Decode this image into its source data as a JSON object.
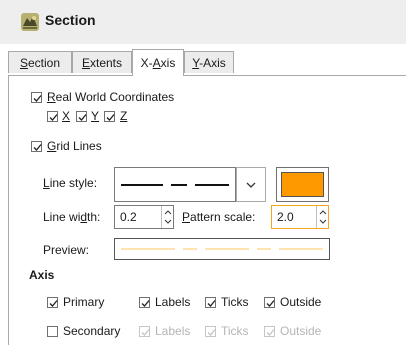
{
  "window": {
    "title": "Section",
    "icon": "section-app-icon"
  },
  "tabs": [
    {
      "label_pre": "",
      "label_key": "S",
      "label_post": "ection",
      "active": false
    },
    {
      "label_pre": "",
      "label_key": "E",
      "label_post": "xtents",
      "active": false
    },
    {
      "label_pre": "X-",
      "label_key": "A",
      "label_post": "xis",
      "active": true
    },
    {
      "label_pre": "",
      "label_key": "Y",
      "label_post": "-Axis",
      "active": false
    }
  ],
  "real_world": {
    "checked": true,
    "label_key": "R",
    "label_rest": "eal World Coordinates",
    "coords": [
      {
        "label": "X",
        "checked": true
      },
      {
        "label": "Y",
        "checked": true
      },
      {
        "label": "Z",
        "checked": true
      }
    ]
  },
  "grid_lines": {
    "checked": true,
    "label_key": "G",
    "label_rest": "rid Lines"
  },
  "line_style": {
    "label_key": "L",
    "label_rest": "ine style:",
    "dropdown_icon": "chevron-down-icon"
  },
  "line_color": {
    "color": "#ff9900"
  },
  "line_width": {
    "label_pre": "Line wi",
    "label_key": "d",
    "label_post": "th:",
    "value": "0.2"
  },
  "pattern_scale": {
    "label_key": "P",
    "label_rest": "attern scale:",
    "value": "2.0"
  },
  "preview": {
    "label": "Preview:"
  },
  "axis": {
    "heading": "Axis",
    "primary": {
      "label": "Primary",
      "checked": true,
      "options": [
        {
          "label": "Labels",
          "checked": true
        },
        {
          "label": "Ticks",
          "checked": true
        },
        {
          "label": "Outside",
          "checked": true
        }
      ]
    },
    "secondary": {
      "label": "Secondary",
      "checked": false,
      "options": [
        {
          "label": "Labels",
          "checked": true
        },
        {
          "label": "Ticks",
          "checked": true
        },
        {
          "label": "Outside",
          "checked": true
        }
      ]
    }
  },
  "colors": {
    "accent": "#ff9900",
    "focus_border": "#f5a623"
  }
}
